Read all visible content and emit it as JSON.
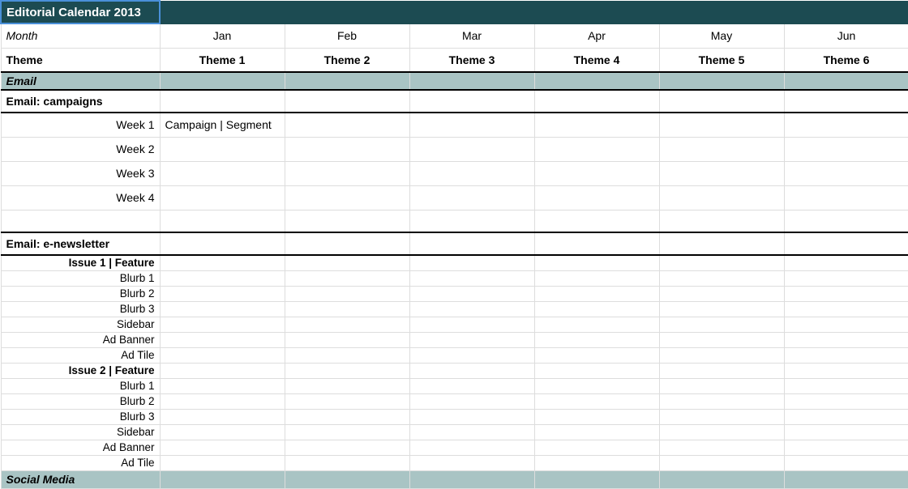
{
  "title": "Editorial Calendar 2013",
  "headers": {
    "month_label": "Month",
    "theme_label": "Theme"
  },
  "months": [
    "Jan",
    "Feb",
    "Mar",
    "Apr",
    "May",
    "Jun"
  ],
  "themes": [
    "Theme 1",
    "Theme 2",
    "Theme 3",
    "Theme 4",
    "Theme 5",
    "Theme 6"
  ],
  "sections": {
    "email": {
      "label": "Email"
    },
    "social": {
      "label": "Social Media"
    }
  },
  "email_campaigns": {
    "label": "Email: campaigns",
    "weeks": [
      "Week 1",
      "Week 2",
      "Week 3",
      "Week 4"
    ],
    "week1_jan": "Campaign | Segment"
  },
  "email_newsletter": {
    "label": "Email: e-newsletter",
    "issue1": {
      "header": "Issue 1 | Feature",
      "items": [
        "Blurb 1",
        "Blurb 2",
        "Blurb 3",
        "Sidebar",
        "Ad Banner",
        "Ad Tile"
      ]
    },
    "issue2": {
      "header": "Issue 2 | Feature",
      "items": [
        "Blurb 1",
        "Blurb 2",
        "Blurb 3",
        "Sidebar",
        "Ad Banner",
        "Ad Tile"
      ]
    }
  }
}
